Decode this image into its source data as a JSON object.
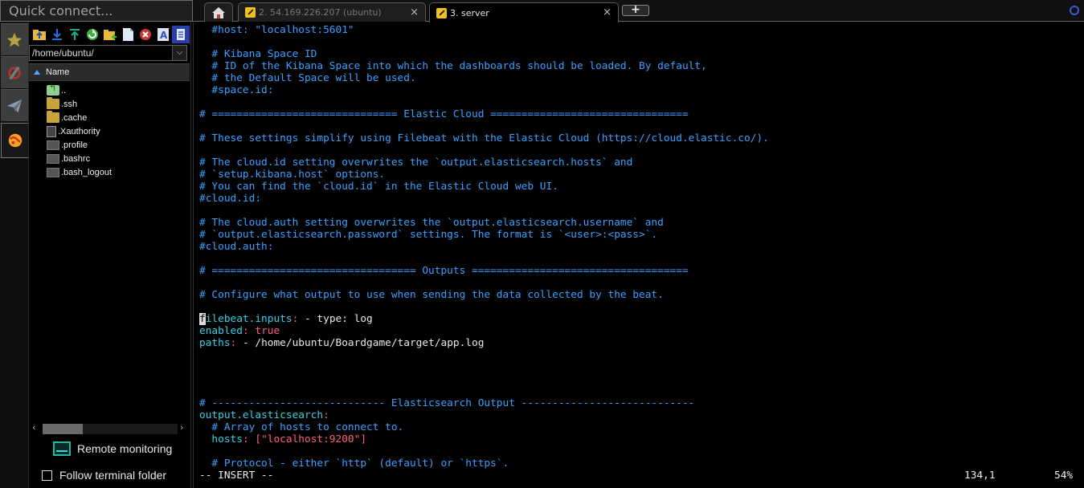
{
  "quick_connect": {
    "placeholder": "Quick connect..."
  },
  "tabs": [
    {
      "label": "2. 54.169.226.207 (ubuntu)",
      "active": false
    },
    {
      "label": "3. server",
      "active": true
    }
  ],
  "sftp": {
    "path": "/home/ubuntu/",
    "column_header": "Name",
    "files": [
      {
        "name": "..",
        "icon": "parent-folder-icon"
      },
      {
        "name": ".ssh",
        "icon": "folder-icon"
      },
      {
        "name": ".cache",
        "icon": "folder-icon"
      },
      {
        "name": ".Xauthority",
        "icon": "file-icon"
      },
      {
        "name": ".profile",
        "icon": "file-icon"
      },
      {
        "name": ".bashrc",
        "icon": "file-icon"
      },
      {
        "name": ".bash_logout",
        "icon": "file-icon"
      }
    ],
    "remote_monitoring": "Remote monitoring",
    "follow_terminal_folder": "Follow terminal folder"
  },
  "terminal": {
    "lines": [
      [
        {
          "t": "  #host: \"localhost:5601\"",
          "c": "comment"
        }
      ],
      [
        {
          "t": "",
          "c": "white"
        }
      ],
      [
        {
          "t": "  # Kibana Space ID",
          "c": "comment"
        }
      ],
      [
        {
          "t": "  # ID of the Kibana Space into which the dashboards should be loaded. By default,",
          "c": "comment"
        }
      ],
      [
        {
          "t": "  # the Default Space will be used.",
          "c": "comment"
        }
      ],
      [
        {
          "t": "  #space.id:",
          "c": "comment"
        }
      ],
      [
        {
          "t": "",
          "c": "white"
        }
      ],
      [
        {
          "t": "# ============================== Elastic Cloud ================================",
          "c": "comment"
        }
      ],
      [
        {
          "t": "",
          "c": "white"
        }
      ],
      [
        {
          "t": "# These settings simplify using Filebeat with the Elastic Cloud (https://cloud.elastic.co/).",
          "c": "comment"
        }
      ],
      [
        {
          "t": "",
          "c": "white"
        }
      ],
      [
        {
          "t": "# The cloud.id setting overwrites the `output.elasticsearch.hosts` and",
          "c": "comment"
        }
      ],
      [
        {
          "t": "# `setup.kibana.host` options.",
          "c": "comment"
        }
      ],
      [
        {
          "t": "# You can find the `cloud.id` in the Elastic Cloud web UI.",
          "c": "comment"
        }
      ],
      [
        {
          "t": "#cloud.id:",
          "c": "comment"
        }
      ],
      [
        {
          "t": "",
          "c": "white"
        }
      ],
      [
        {
          "t": "# The cloud.auth setting overwrites the `output.elasticsearch.username` and",
          "c": "comment"
        }
      ],
      [
        {
          "t": "# `output.elasticsearch.password` settings. The format is `<user>:<pass>`.",
          "c": "comment"
        }
      ],
      [
        {
          "t": "#cloud.auth:",
          "c": "comment"
        }
      ],
      [
        {
          "t": "",
          "c": "white"
        }
      ],
      [
        {
          "t": "# ================================= Outputs ===================================",
          "c": "comment"
        }
      ],
      [
        {
          "t": "",
          "c": "white"
        }
      ],
      [
        {
          "t": "# Configure what output to use when sending the data collected by the beat.",
          "c": "comment"
        }
      ],
      [
        {
          "t": "",
          "c": "white"
        }
      ],
      [
        {
          "t": "f",
          "c": "cursor"
        },
        {
          "t": "ilebeat.inputs",
          "c": "key"
        },
        {
          "t": ":",
          "c": "str"
        },
        {
          "t": " - type: log",
          "c": "white"
        }
      ],
      [
        {
          "t": "enabled",
          "c": "key"
        },
        {
          "t": ":",
          "c": "str"
        },
        {
          "t": " true",
          "c": "str"
        }
      ],
      [
        {
          "t": "paths",
          "c": "key"
        },
        {
          "t": ":",
          "c": "str"
        },
        {
          "t": " - /home/ubuntu/Boardgame/target/app.log",
          "c": "white"
        }
      ],
      [
        {
          "t": "",
          "c": "white"
        }
      ],
      [
        {
          "t": "",
          "c": "white"
        }
      ],
      [
        {
          "t": "",
          "c": "white"
        }
      ],
      [
        {
          "t": "",
          "c": "white"
        }
      ],
      [
        {
          "t": "# ---------------------------- Elasticsearch Output ----------------------------",
          "c": "comment"
        }
      ],
      [
        {
          "t": "output.elasticsearch",
          "c": "key"
        },
        {
          "t": ":",
          "c": "str"
        }
      ],
      [
        {
          "t": "  # Array of hosts to connect to.",
          "c": "comment"
        }
      ],
      [
        {
          "t": "  hosts",
          "c": "key"
        },
        {
          "t": ": ",
          "c": "str"
        },
        {
          "t": "[\"localhost:9200\"]",
          "c": "str"
        }
      ],
      [
        {
          "t": "",
          "c": "white"
        }
      ],
      [
        {
          "t": "  # Protocol - either `http` (default) or `https`.",
          "c": "comment"
        }
      ]
    ],
    "status_mode": "-- INSERT --",
    "status_position": "134,1",
    "status_percent": "54%"
  },
  "colors": {
    "comment": "#3aa0ff",
    "key": "#3ad0e6",
    "string": "#ff5f7f",
    "accent": "#1fb9a8"
  }
}
